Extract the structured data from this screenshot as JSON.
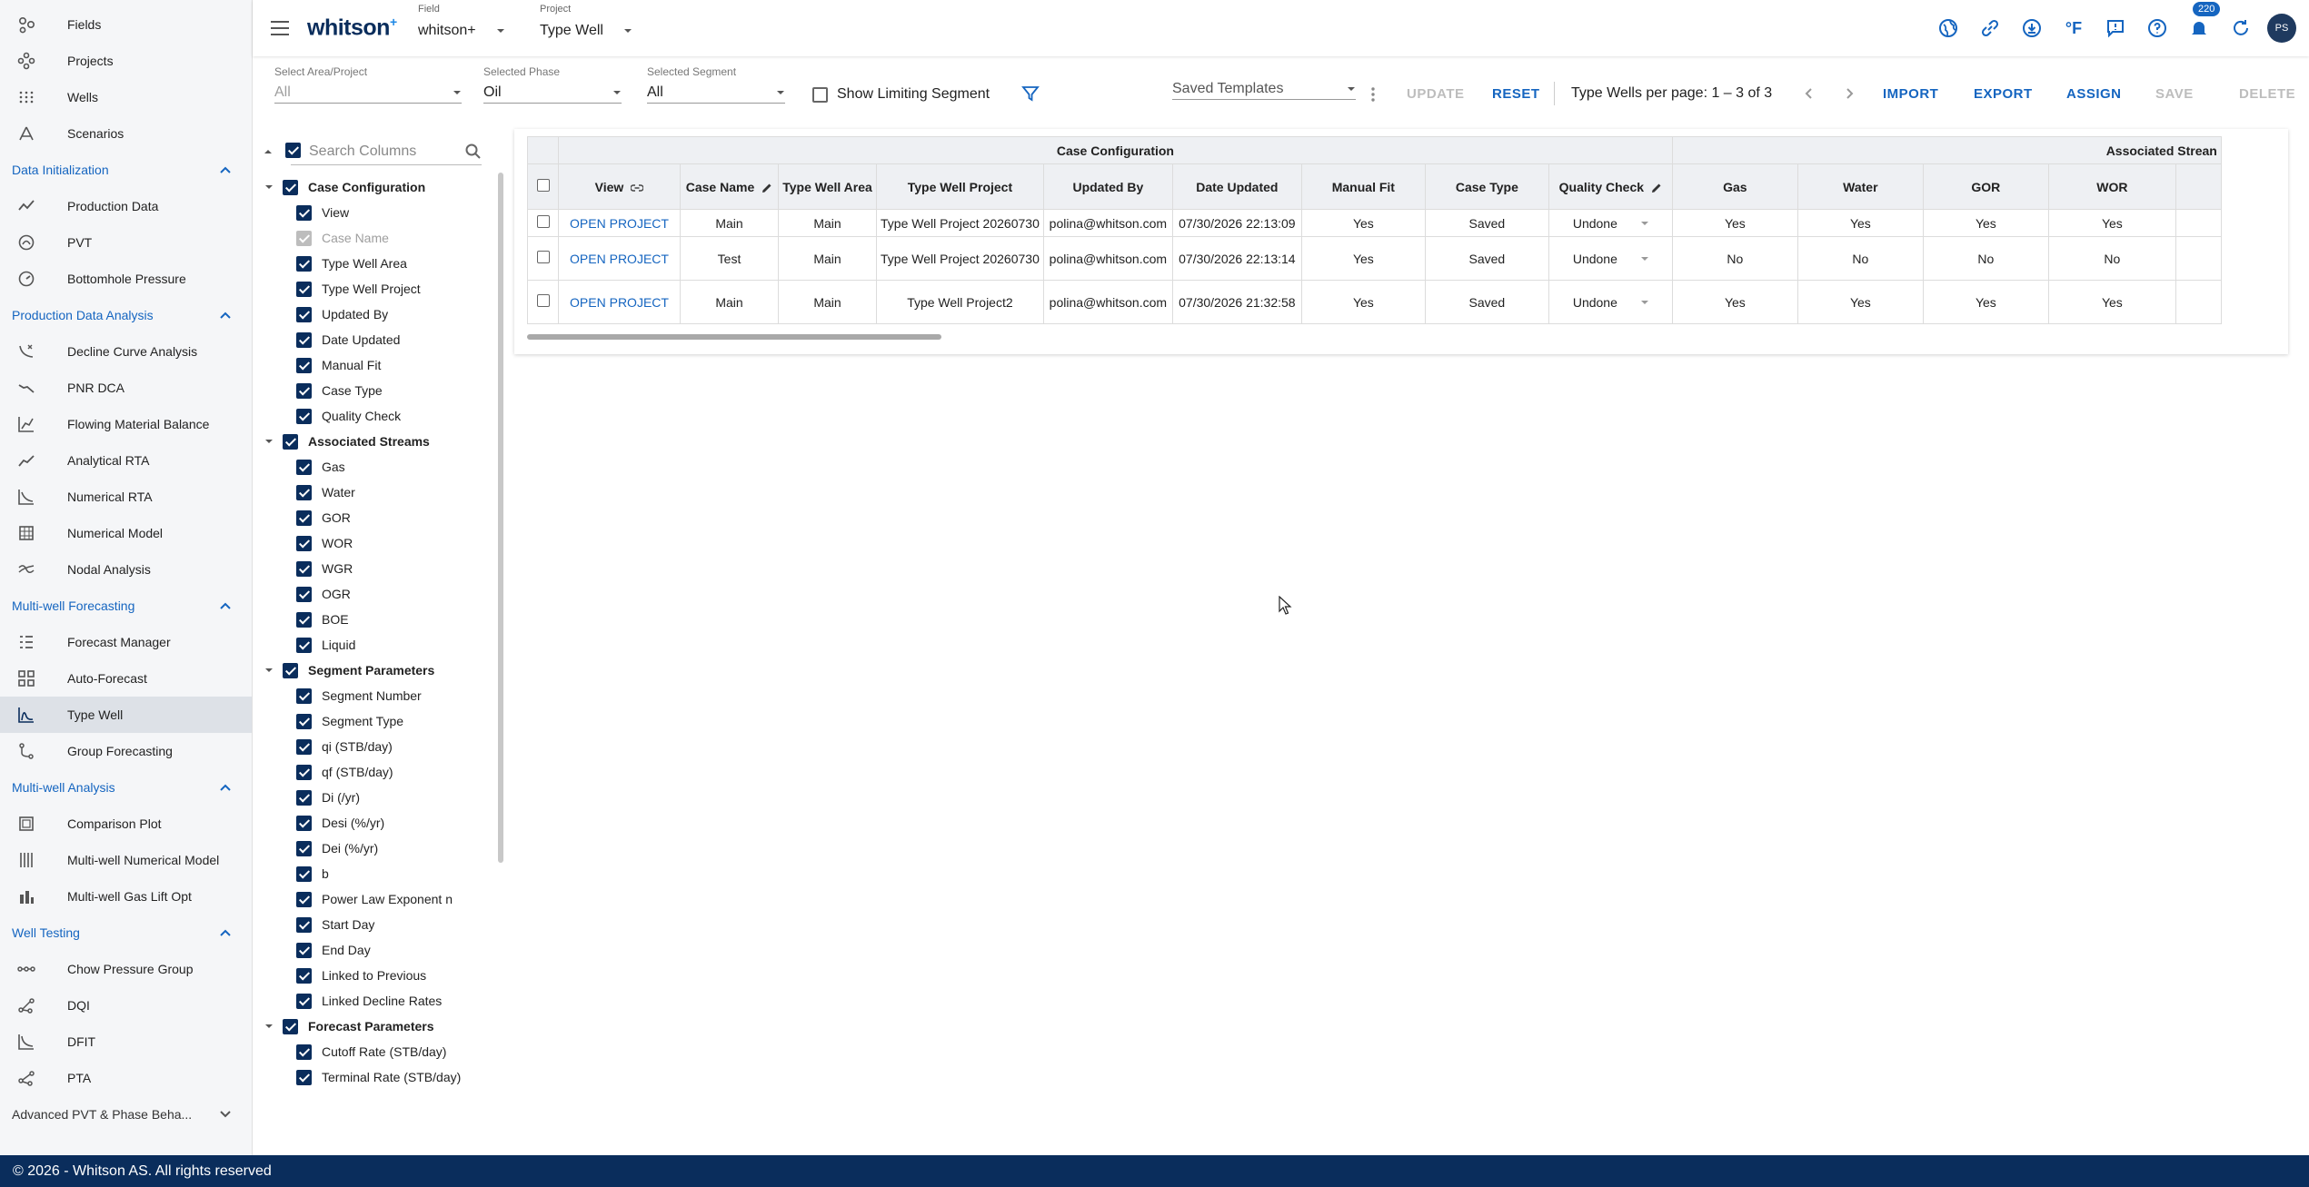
{
  "sidebar": {
    "items": [
      {
        "type": "item",
        "label": "Fields",
        "icon": "fields-icon"
      },
      {
        "type": "item",
        "label": "Projects",
        "icon": "projects-icon"
      },
      {
        "type": "item",
        "label": "Wells",
        "icon": "wells-icon"
      },
      {
        "type": "item",
        "label": "Scenarios",
        "icon": "scenarios-icon"
      },
      {
        "type": "section",
        "label": "Data Initialization"
      },
      {
        "type": "item",
        "label": "Production Data",
        "icon": "production-data-icon"
      },
      {
        "type": "item",
        "label": "PVT",
        "icon": "pvt-icon"
      },
      {
        "type": "item",
        "label": "Bottomhole Pressure",
        "icon": "bottomhole-pressure-icon"
      },
      {
        "type": "section",
        "label": "Production Data Analysis"
      },
      {
        "type": "item",
        "label": "Decline Curve Analysis",
        "icon": "decline-curve-icon"
      },
      {
        "type": "item",
        "label": "PNR DCA",
        "icon": "pnr-dca-icon"
      },
      {
        "type": "item",
        "label": "Flowing Material Balance",
        "icon": "flowing-material-balance-icon"
      },
      {
        "type": "item",
        "label": "Analytical RTA",
        "icon": "analytical-rta-icon"
      },
      {
        "type": "item",
        "label": "Numerical RTA",
        "icon": "numerical-rta-icon"
      },
      {
        "type": "item",
        "label": "Numerical Model",
        "icon": "numerical-model-icon"
      },
      {
        "type": "item",
        "label": "Nodal Analysis",
        "icon": "nodal-analysis-icon"
      },
      {
        "type": "section",
        "label": "Multi-well Forecasting"
      },
      {
        "type": "item",
        "label": "Forecast Manager",
        "icon": "forecast-manager-icon"
      },
      {
        "type": "item",
        "label": "Auto-Forecast",
        "icon": "auto-forecast-icon"
      },
      {
        "type": "item",
        "label": "Type Well",
        "icon": "type-well-icon",
        "active": true
      },
      {
        "type": "item",
        "label": "Group Forecasting",
        "icon": "group-forecasting-icon"
      },
      {
        "type": "section",
        "label": "Multi-well Analysis"
      },
      {
        "type": "item",
        "label": "Comparison Plot",
        "icon": "comparison-plot-icon"
      },
      {
        "type": "item",
        "label": "Multi-well Numerical Model",
        "icon": "multiwell-numerical-model-icon"
      },
      {
        "type": "item",
        "label": "Multi-well Gas Lift Opt",
        "icon": "gas-lift-icon"
      },
      {
        "type": "section",
        "label": "Well Testing"
      },
      {
        "type": "item",
        "label": "Chow Pressure Group",
        "icon": "chow-pressure-icon"
      },
      {
        "type": "item",
        "label": "DQI",
        "icon": "dqi-icon"
      },
      {
        "type": "item",
        "label": "DFIT",
        "icon": "dfit-icon"
      },
      {
        "type": "item",
        "label": "PTA",
        "icon": "pta-icon"
      },
      {
        "type": "section-collapsed",
        "label": "Advanced PVT & Phase Beha..."
      }
    ]
  },
  "header": {
    "logo": "whitson",
    "logo_sup": "+",
    "field_label": "Field",
    "field_value": "whitson+",
    "project_label": "Project",
    "project_value": "Type Well",
    "temp_unit": "°F",
    "notification_count": "220",
    "avatar": "PS"
  },
  "toolbar": {
    "area_label": "Select Area/Project",
    "area_value": "All",
    "phase_label": "Selected Phase",
    "phase_value": "Oil",
    "segment_label": "Selected Segment",
    "segment_value": "All",
    "limiting_label": "Show Limiting Segment",
    "templates_placeholder": "Saved Templates",
    "update": "UPDATE",
    "reset": "RESET",
    "pager": "Type Wells per page: 1 – 3 of 3",
    "import": "IMPORT",
    "export": "EXPORT",
    "assign": "ASSIGN",
    "save": "SAVE",
    "delete": "DELETE"
  },
  "columns_panel": {
    "search_placeholder": "Search Columns",
    "groups": [
      {
        "label": "Case Configuration",
        "items": [
          "View",
          "Case Name",
          "Type Well Area",
          "Type Well Project",
          "Updated By",
          "Date Updated",
          "Manual Fit",
          "Case Type",
          "Quality Check"
        ]
      },
      {
        "label": "Associated Streams",
        "items": [
          "Gas",
          "Water",
          "GOR",
          "WOR",
          "WGR",
          "OGR",
          "BOE",
          "Liquid"
        ]
      },
      {
        "label": "Segment Parameters",
        "items": [
          "Segment Number",
          "Segment Type",
          "qi (STB/day)",
          "qf (STB/day)",
          "Di (/yr)",
          "Desi (%/yr)",
          "Dei (%/yr)",
          "b",
          "Power Law Exponent n",
          "Start Day",
          "End Day",
          "Linked to Previous",
          "Linked Decline Rates"
        ]
      },
      {
        "label": "Forecast Parameters",
        "items": [
          "Cutoff Rate (STB/day)",
          "Terminal Rate (STB/day)"
        ]
      }
    ],
    "disabled_item": "Case Name"
  },
  "grid": {
    "group_headers": [
      "Case Configuration",
      "Associated Strean"
    ],
    "columns": [
      "View",
      "Case Name",
      "Type Well Area",
      "Type Well Project",
      "Updated By",
      "Date Updated",
      "Manual Fit",
      "Case Type",
      "Quality Check",
      "Gas",
      "Water",
      "GOR",
      "WOR"
    ],
    "rows": [
      [
        "OPEN PROJECT",
        "Main",
        "Main",
        "Type Well Project 20260730",
        "polina@whitson.com",
        "07/30/2026 22:13:09",
        "Yes",
        "Saved",
        "Undone",
        "Yes",
        "Yes",
        "Yes",
        "Yes"
      ],
      [
        "OPEN PROJECT",
        "Test",
        "Main",
        "Type Well Project 20260730",
        "polina@whitson.com",
        "07/30/2026 22:13:14",
        "Yes",
        "Saved",
        "Undone",
        "No",
        "No",
        "No",
        "No"
      ],
      [
        "OPEN PROJECT",
        "Main",
        "Main",
        "Type Well Project2",
        "polina@whitson.com",
        "07/30/2026 21:32:58",
        "Yes",
        "Saved",
        "Undone",
        "Yes",
        "Yes",
        "Yes",
        "Yes"
      ]
    ]
  },
  "footer": {
    "text": "© 2026 - Whitson AS. All rights reserved"
  },
  "colors": {
    "brand": "#0a2d5c",
    "accent": "#1565c0"
  }
}
